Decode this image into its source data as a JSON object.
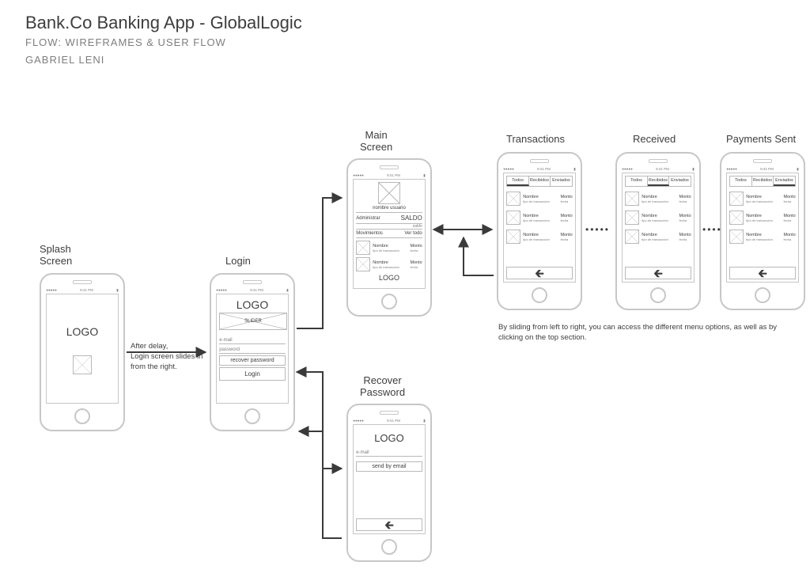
{
  "header": {
    "title": "Bank.Co Banking App - GlobalLogic",
    "subtitle": "FLOW: WIREFRAMES & USER FLOW",
    "author": "GABRIEL LENI"
  },
  "common": {
    "status_left": "●●●●●",
    "status_time": "9:41 PM",
    "status_batt": "▮"
  },
  "labels": {
    "splash": "Splash\nScreen",
    "login": "Login",
    "main": "Main\nScreen",
    "recover": "Recover\nPassword",
    "transactions": "Transactions",
    "received": "Received",
    "sent": "Payments Sent"
  },
  "splash": {
    "logo": "LOGO"
  },
  "login": {
    "logo": "LOGO",
    "slider": "SLIDER",
    "email": "e-mail",
    "password": "password",
    "recover": "recover password",
    "login_btn": "Login"
  },
  "main": {
    "username": "nombre usuario",
    "manage": "Administrar",
    "balance": "SALDO",
    "balance_label": "saldo",
    "movements": "Movimientos",
    "view_all": "Ver todo",
    "tx": [
      {
        "name": "Nombre",
        "type": "tipo de transacción",
        "amount": "Monto",
        "date": "fecha"
      },
      {
        "name": "Nombre",
        "type": "tipo de transacción",
        "amount": "Monto",
        "date": "fecha"
      }
    ],
    "logo": "LOGO"
  },
  "recover": {
    "logo": "LOGO",
    "email": "e-mail",
    "send": "send by email"
  },
  "tabs": {
    "todos": "Todos",
    "recibidos": "Recibidos",
    "enviados": "Enviados"
  },
  "tx_item": {
    "name": "Nombre",
    "type": "tipo de transacción",
    "amount": "Monto",
    "date": "fecha"
  },
  "captions": {
    "after_splash": "After delay,\nLogin screen slides in\nfrom the right.",
    "slide_hint": "By sliding from left to right, you can access the different menu options, as well as by clicking on the top section."
  }
}
